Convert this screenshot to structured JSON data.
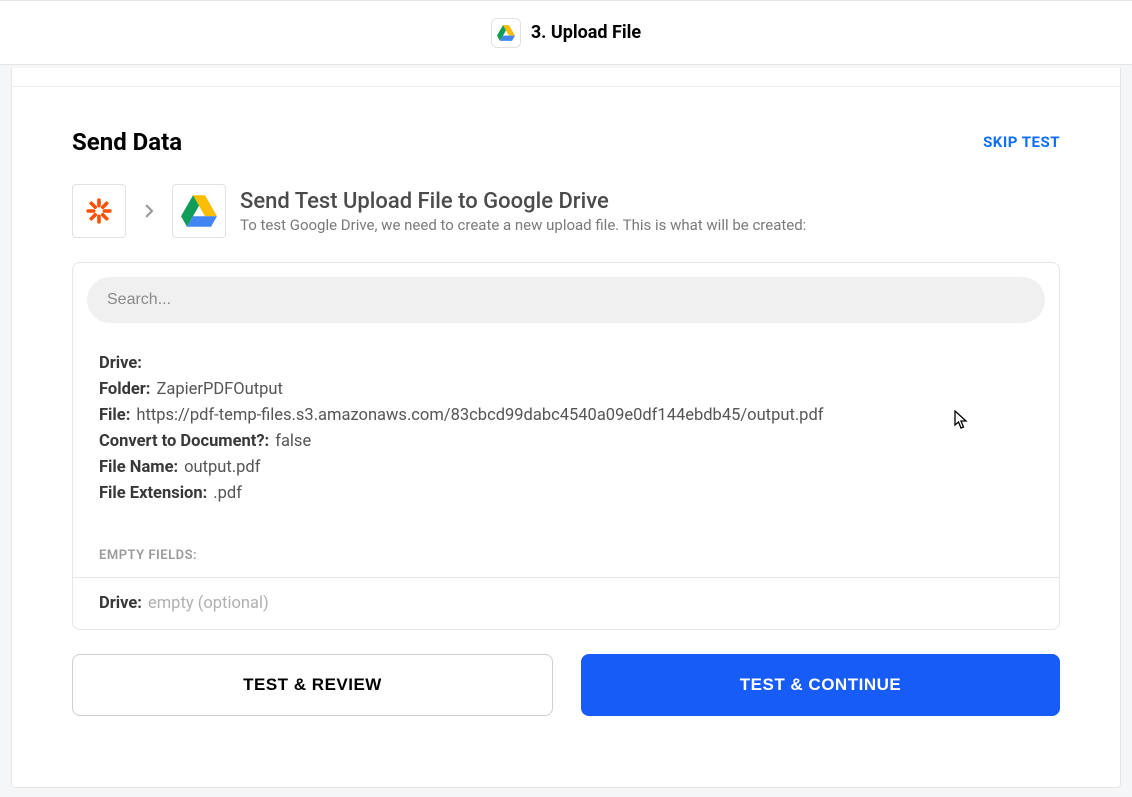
{
  "header": {
    "step_title": "3. Upload File"
  },
  "section": {
    "title": "Send Data",
    "skip_label": "SKIP TEST"
  },
  "subhead": {
    "title": "Send Test Upload File to Google Drive",
    "description": "To test Google Drive, we need to create a new upload file. This is what will be created:"
  },
  "search": {
    "placeholder": "Search..."
  },
  "fields": {
    "drive": {
      "label": "Drive:",
      "value": ""
    },
    "folder": {
      "label": "Folder:",
      "value": "ZapierPDFOutput"
    },
    "file": {
      "label": "File:",
      "value": "https://pdf-temp-files.s3.amazonaws.com/83cbcd99dabc4540a09e0df144ebdb45/output.pdf"
    },
    "convert": {
      "label": "Convert to Document?:",
      "value": "false"
    },
    "filename": {
      "label": "File Name:",
      "value": "output.pdf"
    },
    "extension": {
      "label": "File Extension:",
      "value": ".pdf"
    }
  },
  "empty_section": {
    "header": "EMPTY FIELDS:",
    "drive_label": "Drive:",
    "drive_value": "empty (optional)"
  },
  "buttons": {
    "review": "TEST & REVIEW",
    "continue": "TEST & CONTINUE"
  }
}
